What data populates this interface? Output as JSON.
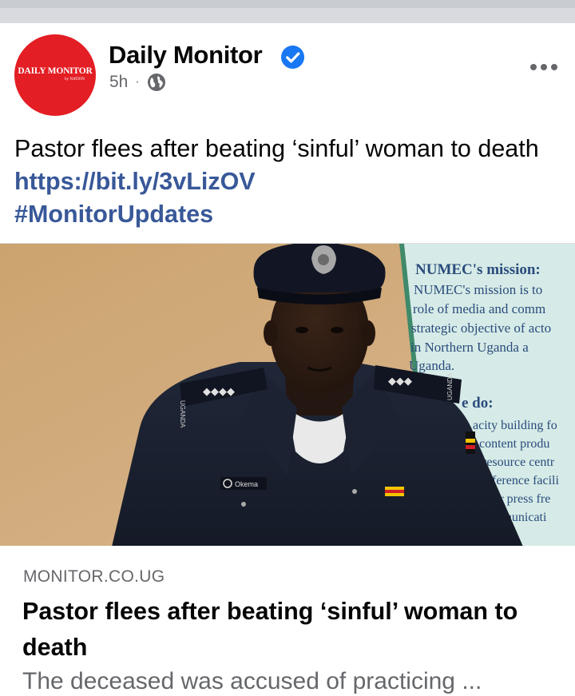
{
  "post": {
    "author": "Daily Monitor",
    "time": "5h",
    "separator": "·",
    "avatar_logo_text": "DAILY MONITOR",
    "avatar_logo_sub": "by NATION",
    "text": "Pastor flees after beating ‘sinful’ woman to death",
    "link": "https://bit.ly/3vLizOV",
    "hashtag": "#MonitorUpdates"
  },
  "photo": {
    "poster_heading": "NUMEC's mission:",
    "poster_lines": [
      "NUMEC's mission is to",
      "role of media and comm",
      "strategic objective of acto",
      "in  Northern  Uganda  a",
      "Uganda."
    ],
    "poster_subheading": "e do:",
    "poster_items": [
      "acity building fo",
      "content produ",
      "resource centr",
      "nference facili",
      "for press fre",
      "mmunicati"
    ],
    "shoulder_text_left": "UGANDA",
    "shoulder_text_right": "UGANDA",
    "name_tag": "Okema"
  },
  "link_preview": {
    "domain": "MONITOR.CO.UG",
    "title": "Pastor flees after beating ‘sinful’ woman to death",
    "description": "The deceased was accused of practicing ..."
  },
  "colors": {
    "brand_red": "#e31e24",
    "link_blue": "#385898",
    "verified_blue": "#1877f2",
    "meta_gray": "#65676b"
  },
  "icons": [
    "verified-badge-icon",
    "globe-icon",
    "more-options-icon"
  ]
}
